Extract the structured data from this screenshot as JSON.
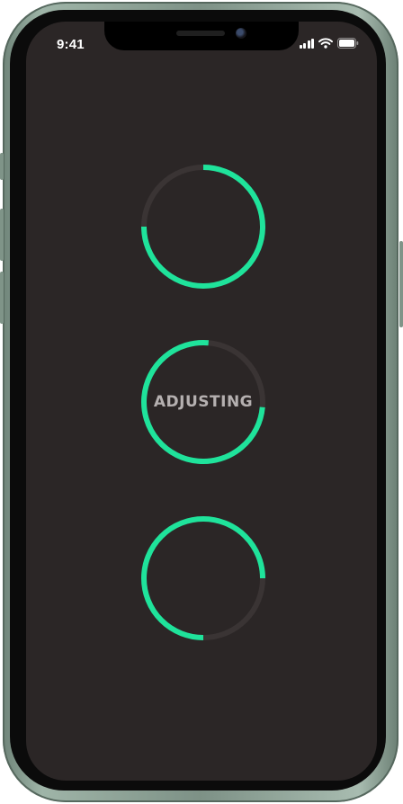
{
  "status_bar": {
    "time": "9:41",
    "icons": [
      "cellular-signal-icon",
      "wifi-icon",
      "battery-icon"
    ]
  },
  "colors": {
    "accent": "#1fe39b",
    "track": "#3a3434",
    "screen_bg": "#2b2626",
    "label": "#b5b0b0"
  },
  "indicators": [
    {
      "label": "",
      "progress": 0.75,
      "start_angle_deg": 0
    },
    {
      "label": "ADJUSTING",
      "progress": 0.75,
      "start_angle_deg": 95
    },
    {
      "label": "",
      "progress": 0.75,
      "start_angle_deg": -180
    }
  ]
}
